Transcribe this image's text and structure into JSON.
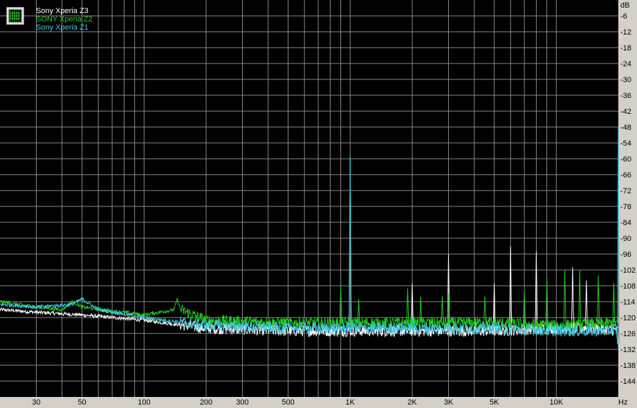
{
  "chart_data": {
    "type": "line",
    "title": "",
    "xlabel": "Hz",
    "ylabel": "dB",
    "xscale": "log",
    "xlim": [
      20,
      20000
    ],
    "ylim": [
      -150,
      0
    ],
    "grid": true,
    "legend_position": "top-left",
    "background": "#000000",
    "grid_color": "#8a8a8a",
    "y_ticks": [
      -6,
      -12,
      -18,
      -24,
      -30,
      -36,
      -42,
      -48,
      -54,
      -60,
      -66,
      -72,
      -78,
      -84,
      -90,
      -96,
      -102,
      -108,
      -114,
      -120,
      -126,
      -132,
      -138,
      -144
    ],
    "x_ticks": [
      {
        "value": 30,
        "label": "30"
      },
      {
        "value": 50,
        "label": "50"
      },
      {
        "value": 100,
        "label": "100"
      },
      {
        "value": 200,
        "label": "200"
      },
      {
        "value": 300,
        "label": "300"
      },
      {
        "value": 500,
        "label": "500"
      },
      {
        "value": 1000,
        "label": "1K"
      },
      {
        "value": 2000,
        "label": "2K"
      },
      {
        "value": 3000,
        "label": "3K"
      },
      {
        "value": 5000,
        "label": "5K"
      },
      {
        "value": 10000,
        "label": "10K"
      }
    ],
    "series": [
      {
        "name": "Sony Xperia Z3",
        "color": "#ffffff",
        "noise_floor": [
          [
            20,
            -117
          ],
          [
            30,
            -118
          ],
          [
            50,
            -119
          ],
          [
            100,
            -121
          ],
          [
            200,
            -124
          ],
          [
            500,
            -125
          ],
          [
            1000,
            -125
          ],
          [
            2000,
            -125
          ],
          [
            5000,
            -125
          ],
          [
            10000,
            -124
          ],
          [
            15000,
            -124
          ],
          [
            20000,
            -125
          ]
        ],
        "peaks": [
          [
            1000,
            -60
          ],
          [
            2000,
            -107
          ],
          [
            3000,
            -96
          ],
          [
            5000,
            -107
          ],
          [
            6000,
            -93
          ],
          [
            8000,
            -95
          ],
          [
            12000,
            -101
          ],
          [
            14000,
            -106
          ]
        ]
      },
      {
        "name": "SONY Xperia Z2",
        "color": "#22cc22",
        "noise_floor": [
          [
            20,
            -114
          ],
          [
            30,
            -116
          ],
          [
            40,
            -117
          ],
          [
            45,
            -114
          ],
          [
            50,
            -116
          ],
          [
            100,
            -119
          ],
          [
            140,
            -117
          ],
          [
            145,
            -113
          ],
          [
            150,
            -117
          ],
          [
            200,
            -121
          ],
          [
            500,
            -122
          ],
          [
            1000,
            -122
          ],
          [
            2000,
            -122
          ],
          [
            5000,
            -122
          ],
          [
            10000,
            -123
          ],
          [
            20000,
            -122
          ]
        ],
        "peaks": [
          [
            1000,
            -60
          ],
          [
            900,
            -108
          ],
          [
            1100,
            -113
          ],
          [
            1900,
            -109
          ],
          [
            2200,
            -112
          ],
          [
            2800,
            -112
          ],
          [
            3000,
            -111
          ],
          [
            4500,
            -112
          ],
          [
            7000,
            -110
          ],
          [
            9000,
            -105
          ],
          [
            11000,
            -102
          ],
          [
            13000,
            -102
          ],
          [
            16000,
            -104
          ],
          [
            19000,
            -107
          ]
        ]
      },
      {
        "name": "Sony Xperia Z1",
        "color": "#40c8e0",
        "noise_floor": [
          [
            20,
            -115
          ],
          [
            30,
            -116
          ],
          [
            45,
            -115
          ],
          [
            50,
            -113
          ],
          [
            60,
            -117
          ],
          [
            100,
            -120
          ],
          [
            200,
            -123
          ],
          [
            500,
            -124
          ],
          [
            1000,
            -124
          ],
          [
            2000,
            -124
          ],
          [
            5000,
            -124
          ],
          [
            10000,
            -125
          ],
          [
            18000,
            -125
          ],
          [
            19500,
            -124
          ],
          [
            20000,
            -130
          ]
        ],
        "peaks": [
          [
            1000,
            -59
          ],
          [
            20000,
            -48
          ]
        ]
      }
    ]
  }
}
